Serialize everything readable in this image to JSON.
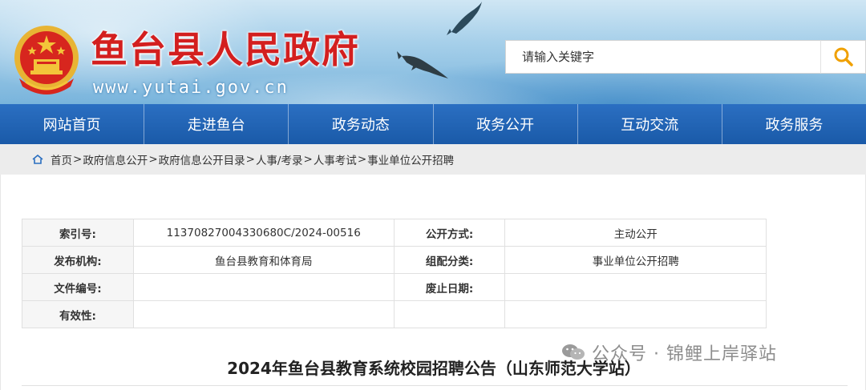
{
  "header": {
    "site_title": "鱼台县人民政府",
    "site_url": "www.yutai.gov.cn",
    "search_placeholder": "请输入关键字",
    "brand_red": "#d31f1f",
    "nav_blue": "#1a5aa8"
  },
  "nav": {
    "items": [
      {
        "label": "网站首页"
      },
      {
        "label": "走进鱼台"
      },
      {
        "label": "政务动态"
      },
      {
        "label": "政务公开"
      },
      {
        "label": "互动交流"
      },
      {
        "label": "政务服务"
      }
    ]
  },
  "breadcrumb": {
    "items": [
      "首页",
      "政府信息公开",
      "政府信息公开目录",
      "人事/考录",
      "人事考试",
      "事业单位公开招聘"
    ],
    "separator": ">"
  },
  "meta_table": {
    "rows": [
      {
        "label1": "索引号:",
        "value1": "11370827004330680C/2024-00516",
        "label2": "公开方式:",
        "value2": "主动公开"
      },
      {
        "label1": "发布机构:",
        "value1": "鱼台县教育和体育局",
        "label2": "组配分类:",
        "value2": "事业单位公开招聘"
      },
      {
        "label1": "文件编号:",
        "value1": "",
        "label2": "废止日期:",
        "value2": ""
      },
      {
        "label1": "有效性:",
        "value1": "",
        "label2": "",
        "value2": ""
      }
    ]
  },
  "article": {
    "title": "2024年鱼台县教育系统校园招聘公告（山东师范大学站）"
  },
  "watermark": {
    "text": "公众号 · 锦鲤上岸驿站"
  }
}
